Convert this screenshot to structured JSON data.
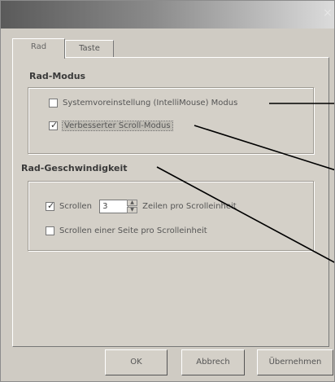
{
  "window": {
    "close_glyph": "×"
  },
  "tabs": [
    {
      "label": "Rad",
      "active": true
    },
    {
      "label": "Taste",
      "active": false
    }
  ],
  "wheel_mode": {
    "title": "Rad-Modus",
    "options": [
      {
        "label": "Systemvoreinstellung (IntelliMouse) Modus",
        "checked": false
      },
      {
        "label": "Verbesserter Scroll-Modus",
        "checked": true
      }
    ]
  },
  "wheel_speed": {
    "title": "Rad-Geschwindigkeit",
    "scroll_lines": {
      "label": "Scrollen",
      "value": "3",
      "suffix": "Zeilen pro Scrolleinheit",
      "checked": true
    },
    "scroll_page": {
      "label": "Scrollen einer Seite pro Scrolleinheit",
      "checked": false
    }
  },
  "buttons": {
    "ok": "OK",
    "cancel": "Abbrech",
    "apply": "Übernehmen"
  },
  "check_glyph": "✓",
  "colors": {
    "dialog_face": "#d4d0c8",
    "title_dark": "#5a5a5a",
    "pointer": "#000000"
  }
}
